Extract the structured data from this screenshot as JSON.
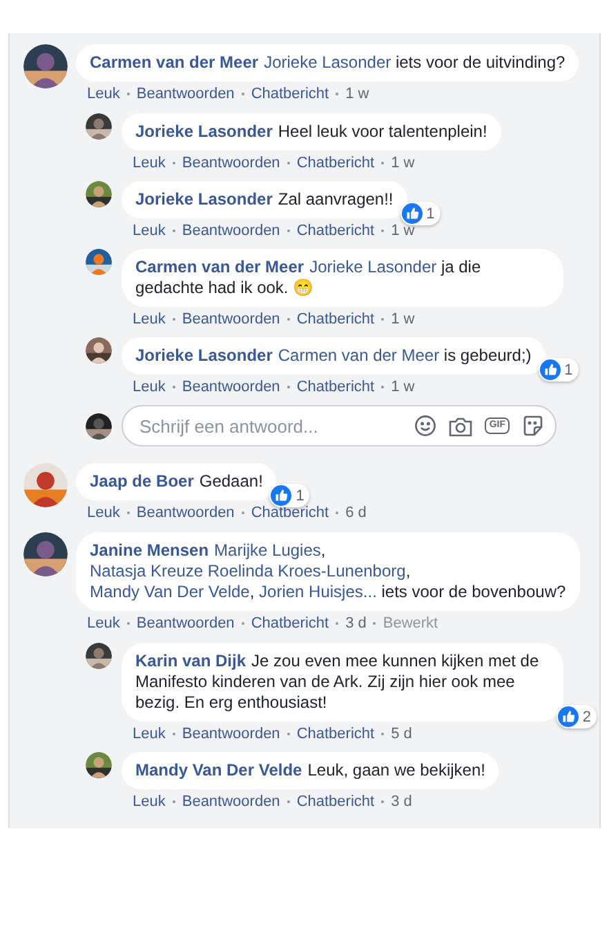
{
  "comments": [
    {
      "author": "Carmen van der Meer",
      "body": [
        {
          "kind": "mention",
          "text": "Jorieke Lasonder"
        },
        {
          "kind": "text",
          "text": " iets voor de uitvinding?"
        }
      ],
      "actions": [
        "Leuk",
        "Beantwoorden",
        "Chatbericht"
      ],
      "time": "1 w",
      "replies": [
        {
          "author": "Jorieke Lasonder",
          "body": [
            {
              "kind": "text",
              "text": "Heel leuk voor talentenplein!"
            }
          ],
          "actions": [
            "Leuk",
            "Beantwoorden",
            "Chatbericht"
          ],
          "time": "1 w"
        },
        {
          "author": "Jorieke Lasonder",
          "body": [
            {
              "kind": "text",
              "text": "Zal aanvragen!!"
            }
          ],
          "actions": [
            "Leuk",
            "Beantwoorden",
            "Chatbericht"
          ],
          "time": "1 w",
          "likes": "1"
        },
        {
          "author": "Carmen van der Meer",
          "body": [
            {
              "kind": "mention",
              "text": "Jorieke Lasonder"
            },
            {
              "kind": "text",
              "text": " ja die gedachte had ik ook. 😁"
            }
          ],
          "actions": [
            "Leuk",
            "Beantwoorden",
            "Chatbericht"
          ],
          "time": "1 w"
        },
        {
          "author": "Jorieke Lasonder",
          "body": [
            {
              "kind": "mention",
              "text": "Carmen van der Meer"
            },
            {
              "kind": "text",
              "text": " is gebeurd;)"
            }
          ],
          "actions": [
            "Leuk",
            "Beantwoorden",
            "Chatbericht"
          ],
          "time": "1 w",
          "likes": "1"
        }
      ],
      "reply_box": {
        "placeholder": "Schrijf een antwoord...",
        "gif_label": "GIF"
      }
    },
    {
      "author": "Jaap de Boer",
      "body": [
        {
          "kind": "text",
          "text": "Gedaan!"
        }
      ],
      "actions": [
        "Leuk",
        "Beantwoorden",
        "Chatbericht"
      ],
      "time": "6 d",
      "likes": "1"
    },
    {
      "author": "Janine Mensen",
      "body": [
        {
          "kind": "mention",
          "text": "Marijke Lugies"
        },
        {
          "kind": "text",
          "text": ", "
        },
        {
          "kind": "mention",
          "text": "Natasja Kreuze"
        },
        {
          "kind": "mention",
          "text": " Roelinda Kroes-Lunenborg"
        },
        {
          "kind": "text",
          "text": ", "
        },
        {
          "kind": "mention",
          "text": "Mandy Van Der Velde"
        },
        {
          "kind": "text",
          "text": ", "
        },
        {
          "kind": "mention",
          "text": "Jorien Huisjes..."
        },
        {
          "kind": "text",
          "text": " iets voor de bovenbouw?"
        }
      ],
      "actions": [
        "Leuk",
        "Beantwoorden",
        "Chatbericht"
      ],
      "time": "3 d",
      "edited": "Bewerkt",
      "replies": [
        {
          "author": "Karin van Dijk",
          "body": [
            {
              "kind": "text",
              "text": "Je zou even mee kunnen kijken met de Manifesto kinderen van de Ark. Zij zijn hier ook mee bezig. En erg enthousiast!"
            }
          ],
          "actions": [
            "Leuk",
            "Beantwoorden",
            "Chatbericht"
          ],
          "time": "5 d",
          "likes": "2"
        },
        {
          "author": "Mandy Van Der Velde",
          "body": [
            {
              "kind": "text",
              "text": "Leuk, gaan we bekijken!"
            }
          ],
          "actions": [
            "Leuk",
            "Beantwoorden",
            "Chatbericht"
          ],
          "time": "3 d"
        }
      ]
    }
  ]
}
